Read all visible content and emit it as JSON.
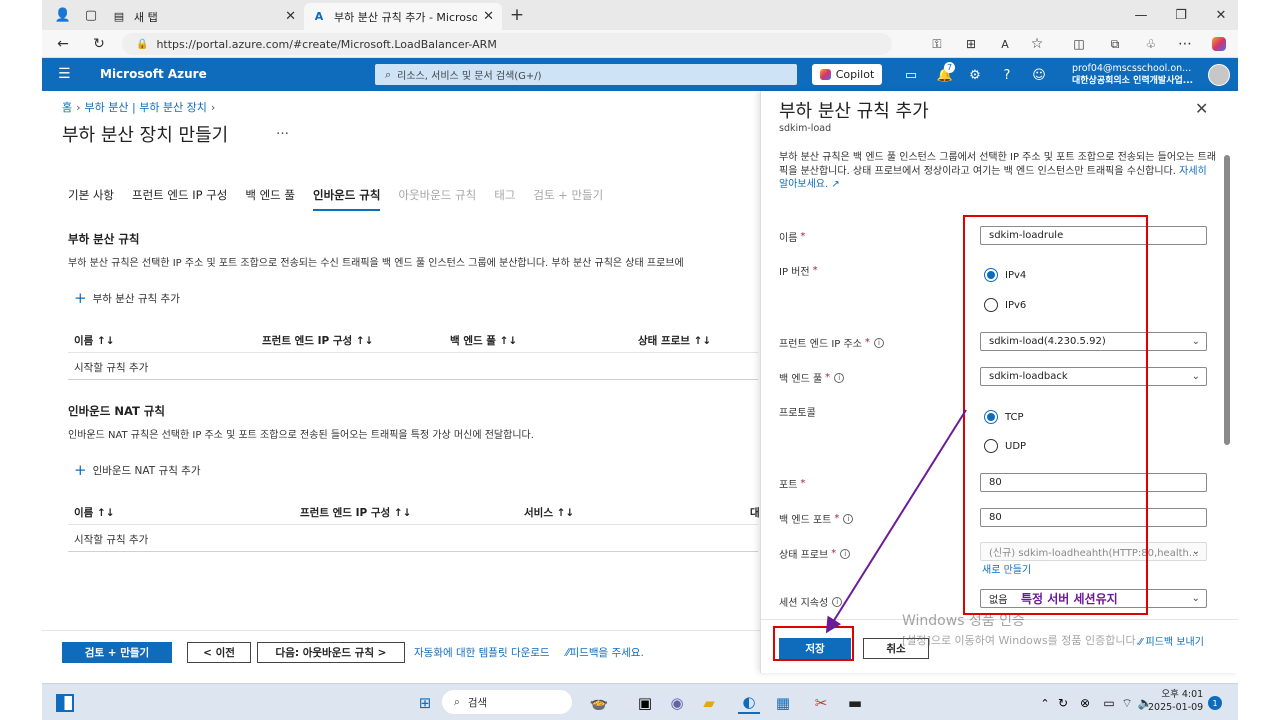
{
  "browser": {
    "tabs": [
      {
        "title": "새 탭"
      },
      {
        "title": "부하 분산 규칙 추가 - Microsoft A"
      }
    ],
    "url": "https://portal.azure.com/#create/Microsoft.LoadBalancer-ARM"
  },
  "azure_header": {
    "brand": "Microsoft Azure",
    "search_placeholder": "리소스, 서비스 및 문서 검색(G+/)",
    "copilot_label": "Copilot",
    "notification_count": "7",
    "account_email": "prof04@mscsschool.on...",
    "account_org": "대한상공회의소 인력개발사업..."
  },
  "main": {
    "breadcrumb": [
      "홈",
      "부하 분산 | 부하 분산 장치"
    ],
    "title": "부하 분산 장치 만들기",
    "more": "…",
    "tabs": [
      {
        "label": "기본 사항",
        "state": "normal"
      },
      {
        "label": "프런트 엔드 IP 구성",
        "state": "normal"
      },
      {
        "label": "백 엔드 풀",
        "state": "normal"
      },
      {
        "label": "인바운드 규칙",
        "state": "active"
      },
      {
        "label": "아웃바운드 규칙",
        "state": "disabled"
      },
      {
        "label": "태그",
        "state": "disabled"
      },
      {
        "label": "검토 + 만들기",
        "state": "disabled"
      }
    ],
    "lb_rules": {
      "title": "부하 분산 규칙",
      "desc": "부하 분산 규칙은 선택한 IP 주소 및 포트 조합으로 전송되는 수신 트래픽을 백 엔드 풀 인스턴스 그룹에 분산합니다. 부하 분산 규칙은 상태 프로브에",
      "add_label": "부하 분산 규칙 추가",
      "columns": [
        "이름 ↑↓",
        "프런트 엔드 IP 구성 ↑↓",
        "백 엔드 풀 ↑↓",
        "상태 프로브 ↑↓"
      ],
      "empty_row": "시작할 규칙 추가"
    },
    "nat_rules": {
      "title": "인바운드 NAT 규칙",
      "desc": "인바운드 NAT 규칙은 선택한 IP 주소 및 포트 조합으로 전송된 들어오는 트래픽을 특정 가상 머신에 전달합니다.",
      "add_label": "인바운드 NAT 규칙 추가",
      "columns": [
        "이름 ↑↓",
        "프런트 엔드 IP 구성 ↑↓",
        "서비스 ↑↓",
        "대-"
      ],
      "empty_row": "시작할 규칙 추가"
    },
    "footer": {
      "review_create": "검토 + 만들기",
      "prev": "< 이전",
      "next": "다음: 아웃바운드 규칙 >",
      "template_link": "자동화에 대한 템플릿 다운로드",
      "feedback_link": "⁄⁄피드백을 주세요."
    }
  },
  "panel": {
    "title": "부하 분산 규칙 추가",
    "subtitle": "sdkim-load",
    "desc": "부하 분산 규칙은 백 엔드 풀 인스턴스 그룹에서 선택한 IP 주소 및 포트 조합으로 전송되는 들어오는 트래픽을 분산합니다. 상태 프로브에서 정상이라고 여기는 백 엔드 인스턴스만 트래픽을 수신합니다.",
    "learn_more": "자세히 알아보세요.",
    "fields": {
      "name_label": "이름",
      "name_value": "sdkim-loadrule",
      "ipver_label": "IP 버전",
      "ipv4": "IPv4",
      "ipv6": "IPv6",
      "frontend_label": "프런트 엔드 IP 주소",
      "frontend_value": "sdkim-load(4.230.5.92)",
      "backend_label": "백 엔드 풀",
      "backend_value": "sdkim-loadback",
      "protocol_label": "프로토콜",
      "tcp": "TCP",
      "udp": "UDP",
      "port_label": "포트",
      "port_value": "80",
      "backend_port_label": "백 엔드 포트",
      "backend_port_value": "80",
      "probe_label": "상태 프로브",
      "probe_value": "(신규) sdkim-loadheahth(HTTP:80,health...",
      "probe_new_link": "새로 만들기",
      "session_label": "세션 지속성",
      "session_value": "없음"
    },
    "annotation": "특정 서버 세션유지",
    "save": "저장",
    "cancel": "취소",
    "feedback": "피드백 보내기"
  },
  "watermark": {
    "line1": "Windows 정품 인증",
    "line2": "[설정]으로 이동하여 Windows를 정품 인증합니다."
  },
  "taskbar": {
    "search": "검색",
    "time": "오후 4:01",
    "date": "2025-01-09",
    "badge": "1"
  },
  "colors": {
    "azure_blue": "#0f6cbd",
    "highlight_red": "#e00000",
    "annotation_purple": "#6a1b9a"
  }
}
